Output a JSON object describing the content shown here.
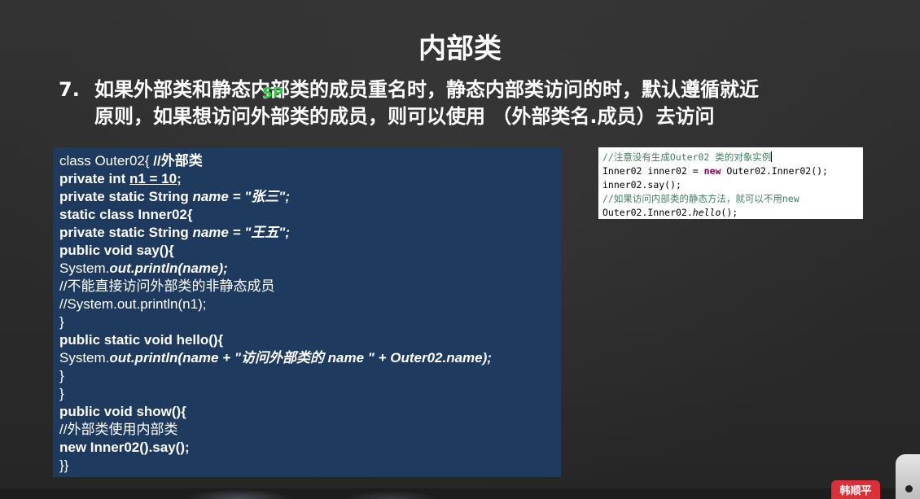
{
  "slide": {
    "title": "内部类",
    "point_number": "7.",
    "point_line1": "如果外部类和静态内部类的成员重名时，静态内部类访问的时，默认遵循就近",
    "point_line2": "原则，如果想访问外部类的成员，则可以使用 （外部类名.成员）去访问"
  },
  "code": {
    "l1_a": "class Outer02{ ",
    "l1_b": "//外部类",
    "l2_a": "private int ",
    "l2_b": "n1 = 10;",
    "l3_a": "private static String ",
    "l3_b": "name = \"张三\";",
    "l4": "static class Inner02{",
    "l5_a": "private static String ",
    "l5_b": "name = \"王五\";",
    "l6": "public void say(){",
    "l7_a": "System.",
    "l7_b": "out.println(name);",
    "l8": "//不能直接访问外部类的非静态成员",
    "l9": "//System.out.println(n1);",
    "l10": "}",
    "l11": "public static void hello(){",
    "l12_a": "System.",
    "l12_b": "out.println(name + \"访问外部类的 name \" + Outer02.name);",
    "l13": "}",
    "l14": "}",
    "l15": "public void show(){",
    "l16": "//外部类使用内部类",
    "l17": "new Inner02().say();",
    "l18": "}}"
  },
  "snippet": {
    "l1": "//注意没有生成Outer02 类的对象实例",
    "l2_a": "Inner02 ",
    "l2_b": "inner02",
    "l2_c": " = ",
    "l2_d": "new",
    "l2_e": " Outer02.Inner02();",
    "l3_a": "inner02",
    "l3_b": ".say();",
    "l4": "//如果访问内部类的静态方法，就可以不用new",
    "l5_a": "Outer02.Inner02.",
    "l5_b": "hello",
    "l5_c": "();"
  },
  "overlay": {
    "badge": "韩顺平",
    "cursor_glyph": "SP"
  },
  "colors": {
    "code_bg": "#1f3a5f",
    "comment_green": "#3f7f5f",
    "keyword_purple": "#7f0055",
    "badge_red": "#d9303a"
  }
}
